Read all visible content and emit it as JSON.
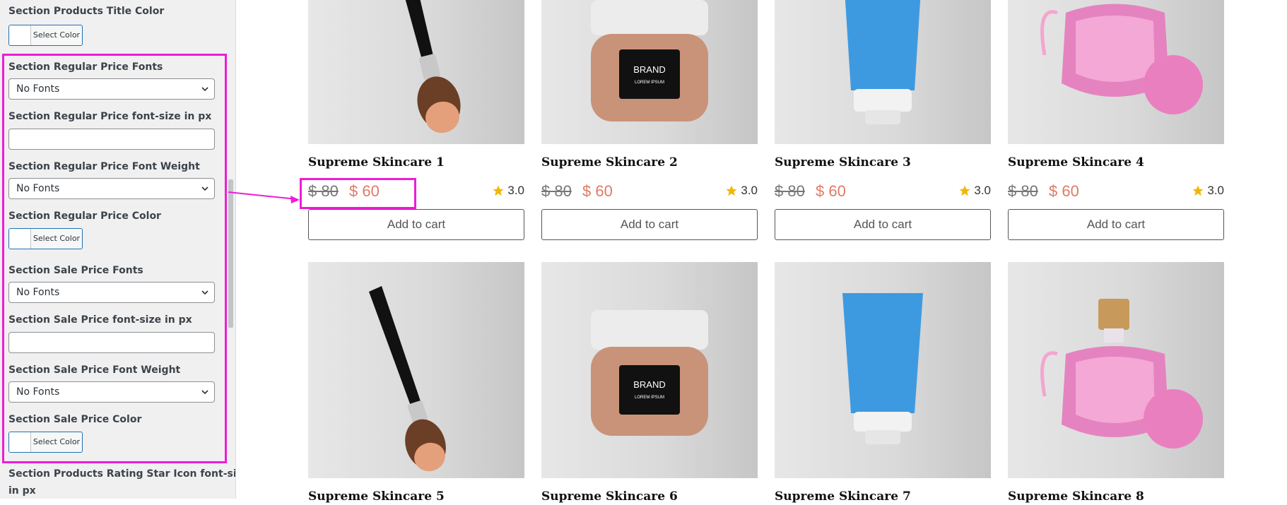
{
  "panel": {
    "title_color": {
      "label": "Section Products Title Color",
      "button": "Select Color"
    },
    "regular_price_fonts": {
      "label": "Section Regular Price Fonts",
      "value": "No Fonts"
    },
    "regular_price_size": {
      "label": "Section Regular Price font-size in px",
      "value": ""
    },
    "regular_price_weight": {
      "label": "Section Regular Price Font Weight",
      "value": "No Fonts"
    },
    "regular_price_color": {
      "label": "Section Regular Price Color",
      "button": "Select Color"
    },
    "sale_price_fonts": {
      "label": "Section Sale Price Fonts",
      "value": "No Fonts"
    },
    "sale_price_size": {
      "label": "Section Sale Price font-size in px",
      "value": ""
    },
    "sale_price_weight": {
      "label": "Section Sale Price Font Weight",
      "value": "No Fonts"
    },
    "sale_price_color": {
      "label": "Section Sale Price Color",
      "button": "Select Color"
    },
    "rating_star_size": {
      "label_line1": "Section Products Rating Star Icon font-size",
      "label_line2": "in px"
    }
  },
  "products": [
    {
      "title": "Supreme Skincare 1",
      "regular": "$ 80",
      "sale": "$ 60",
      "rating": "3.0",
      "cart": "Add to cart",
      "image": "makeup-brush"
    },
    {
      "title": "Supreme Skincare 2",
      "regular": "$ 80",
      "sale": "$ 60",
      "rating": "3.0",
      "cart": "Add to cart",
      "image": "cream-jar"
    },
    {
      "title": "Supreme Skincare 3",
      "regular": "$ 80",
      "sale": "$ 60",
      "rating": "3.0",
      "cart": "Add to cart",
      "image": "tube"
    },
    {
      "title": "Supreme Skincare 4",
      "regular": "$ 80",
      "sale": "$ 60",
      "rating": "3.0",
      "cart": "Add to cart",
      "image": "perfume"
    },
    {
      "title": "Supreme Skincare 5",
      "image": "makeup-brush"
    },
    {
      "title": "Supreme Skincare 6",
      "image": "cream-jar"
    },
    {
      "title": "Supreme Skincare 7",
      "image": "tube"
    },
    {
      "title": "Supreme Skincare 8",
      "image": "perfume"
    }
  ],
  "jar_label": {
    "brand": "BRAND",
    "sub": "LOREM IPSUM"
  },
  "colors": {
    "highlight": "#ee1cd6",
    "sale_price": "#e07a66",
    "star": "#f2b705"
  }
}
